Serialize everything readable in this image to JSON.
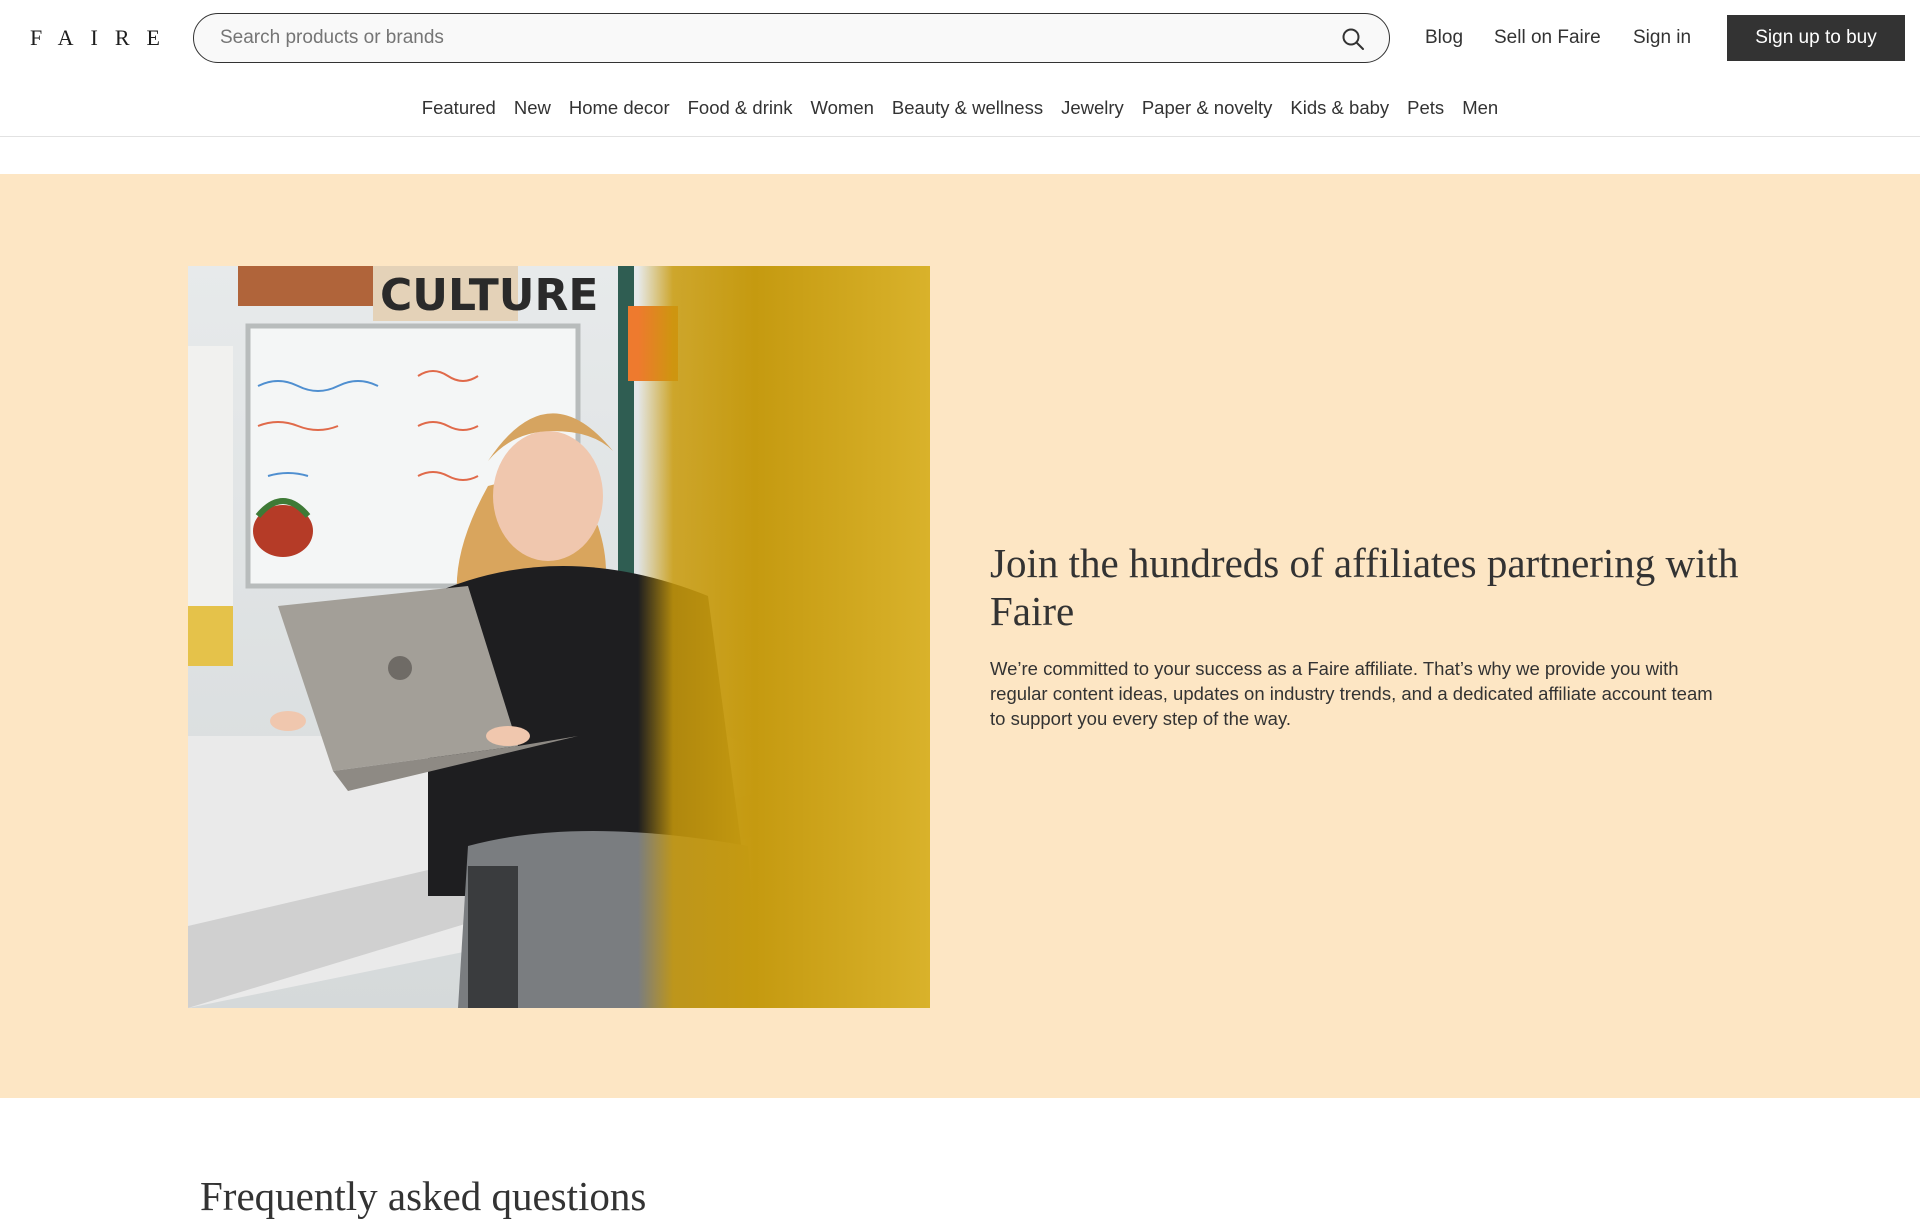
{
  "header": {
    "logo": "FAIRE",
    "search": {
      "placeholder": "Search products or brands",
      "value": ""
    },
    "links": {
      "blog": "Blog",
      "sell": "Sell on Faire",
      "sign_in": "Sign in"
    },
    "signup_button": "Sign up to buy"
  },
  "categories": [
    "Featured",
    "New",
    "Home decor",
    "Food & drink",
    "Women",
    "Beauty & wellness",
    "Jewelry",
    "Paper & novelty",
    "Kids & baby",
    "Pets",
    "Men"
  ],
  "affiliate": {
    "title": "Join the hundreds of affiliates partnering with Faire",
    "body": "We’re committed to your success as a Faire affiliate. That’s why we provide you with regular content ideas, updates on industry trends, and a dedicated affiliate account team to support you every step of the way.",
    "photo_poster_text": "CULTURE",
    "background_color": "#fde6c4"
  },
  "faq": {
    "title": "Frequently asked questions"
  },
  "colors": {
    "text": "#333333",
    "button_bg": "#333333",
    "button_text": "#ffffff",
    "section_bg": "#fde6c4"
  },
  "icons": {
    "search": "search-icon"
  }
}
